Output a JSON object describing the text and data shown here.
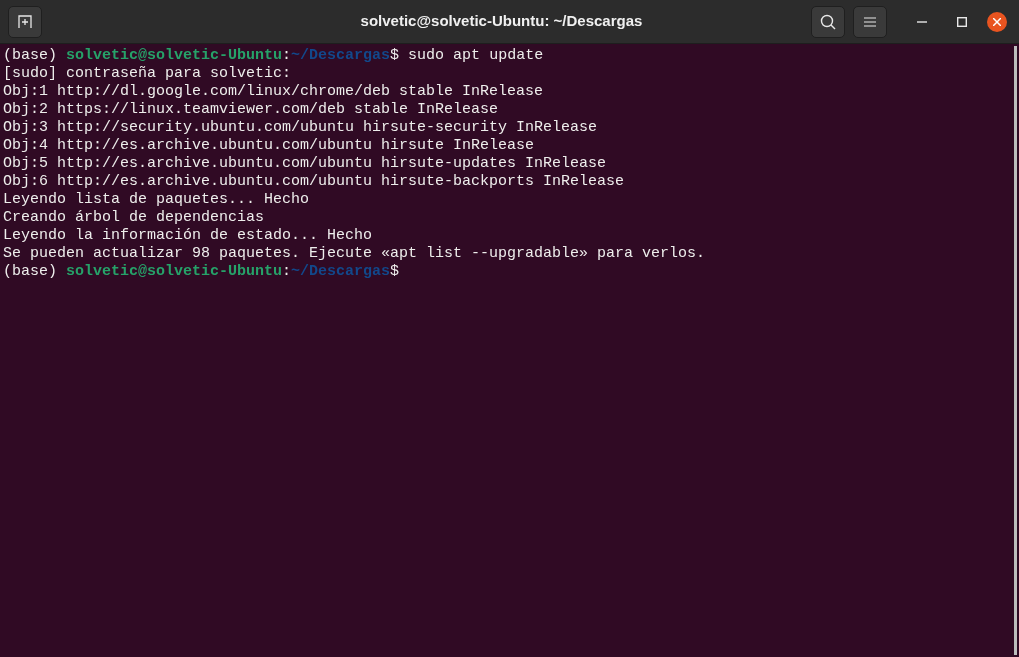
{
  "window": {
    "title": "solvetic@solvetic-Ubuntu: ~/Descargas"
  },
  "terminal": {
    "lines": [
      [
        {
          "kind": "plain",
          "text": "(base) "
        },
        {
          "kind": "user",
          "text": "solvetic@solvetic-Ubuntu"
        },
        {
          "kind": "plain",
          "text": ":"
        },
        {
          "kind": "path",
          "text": "~/Descargas"
        },
        {
          "kind": "plain",
          "text": "$ sudo apt update"
        }
      ],
      [
        {
          "kind": "plain",
          "text": "[sudo] contraseña para solvetic:"
        }
      ],
      [
        {
          "kind": "plain",
          "text": "Obj:1 http://dl.google.com/linux/chrome/deb stable InRelease"
        }
      ],
      [
        {
          "kind": "plain",
          "text": "Obj:2 https://linux.teamviewer.com/deb stable InRelease"
        }
      ],
      [
        {
          "kind": "plain",
          "text": "Obj:3 http://security.ubuntu.com/ubuntu hirsute-security InRelease"
        }
      ],
      [
        {
          "kind": "plain",
          "text": "Obj:4 http://es.archive.ubuntu.com/ubuntu hirsute InRelease"
        }
      ],
      [
        {
          "kind": "plain",
          "text": "Obj:5 http://es.archive.ubuntu.com/ubuntu hirsute-updates InRelease"
        }
      ],
      [
        {
          "kind": "plain",
          "text": "Obj:6 http://es.archive.ubuntu.com/ubuntu hirsute-backports InRelease"
        }
      ],
      [
        {
          "kind": "plain",
          "text": "Leyendo lista de paquetes... Hecho"
        }
      ],
      [
        {
          "kind": "plain",
          "text": "Creando árbol de dependencias"
        }
      ],
      [
        {
          "kind": "plain",
          "text": "Leyendo la información de estado... Hecho"
        }
      ],
      [
        {
          "kind": "plain",
          "text": "Se pueden actualizar 98 paquetes. Ejecute «apt list --upgradable» para verlos."
        }
      ],
      [
        {
          "kind": "plain",
          "text": "(base) "
        },
        {
          "kind": "user",
          "text": "solvetic@solvetic-Ubuntu"
        },
        {
          "kind": "plain",
          "text": ":"
        },
        {
          "kind": "path",
          "text": "~/Descargas"
        },
        {
          "kind": "plain",
          "text": "$"
        }
      ]
    ]
  }
}
